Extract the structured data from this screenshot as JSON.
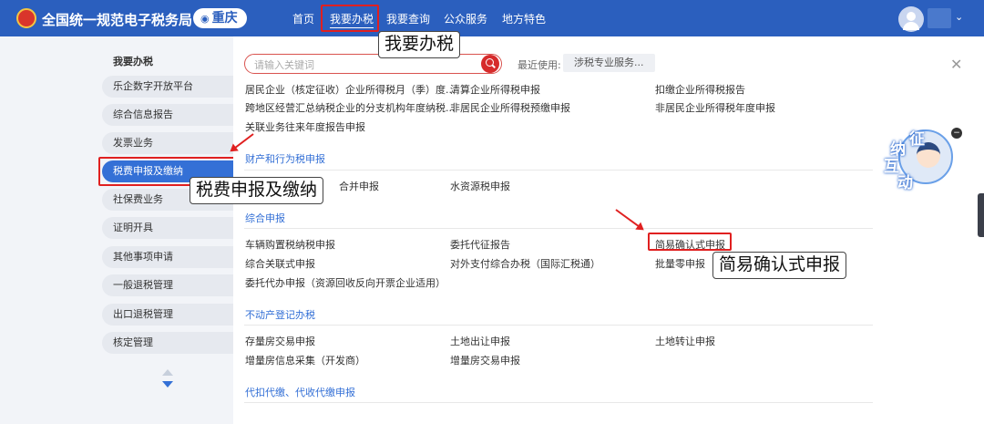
{
  "header": {
    "site_title": "全国统一规范电子税务局",
    "region": "重庆",
    "nav": [
      {
        "label": "首页"
      },
      {
        "label": "我要办税"
      },
      {
        "label": "我要查询"
      },
      {
        "label": "公众服务"
      },
      {
        "label": "地方特色"
      }
    ]
  },
  "sidebar": {
    "heading": "我要办税",
    "items": [
      {
        "label": "乐企数字开放平台"
      },
      {
        "label": "综合信息报告"
      },
      {
        "label": "发票业务"
      },
      {
        "label": "税费申报及缴纳"
      },
      {
        "label": "社保费业务"
      },
      {
        "label": "证明开具"
      },
      {
        "label": "其他事项申请"
      },
      {
        "label": "一般退税管理"
      },
      {
        "label": "出口退税管理"
      },
      {
        "label": "核定管理"
      }
    ]
  },
  "search": {
    "placeholder": "请输入关键词"
  },
  "recent": {
    "label": "最近使用:",
    "chip": "涉税专业服务..."
  },
  "content": {
    "top_rows": [
      [
        "居民企业（核定征收）企业所得税月（季）度...",
        "清算企业所得税申报",
        "扣缴企业所得税报告"
      ],
      [
        "跨地区经营汇总纳税企业的分支机构年度纳税...",
        "非居民企业所得税预缴申报",
        "非居民企业所得税年度申报"
      ],
      [
        "关联业务往来年度报告申报"
      ]
    ],
    "sections": [
      {
        "title": "财产和行为税申报",
        "rows": [
          [
            "合并申报",
            "水资源税申报"
          ]
        ]
      },
      {
        "title": "综合申报",
        "rows": [
          [
            "车辆购置税纳税申报",
            "委托代征报告",
            "简易确认式申报"
          ],
          [
            "综合关联式申报",
            "对外支付综合办税（国际汇税通）",
            "批量零申报"
          ],
          [
            "委托代办申报（资源回收反向开票企业适用）"
          ]
        ]
      },
      {
        "title": "不动产登记办税",
        "rows": [
          [
            "存量房交易申报",
            "土地出让申报",
            "土地转让申报"
          ],
          [
            "增量房信息采集（开发商）",
            "增量房交易申报"
          ]
        ]
      },
      {
        "title": "代扣代缴、代收代缴申报",
        "rows": []
      }
    ]
  },
  "callouts": {
    "nav": "我要办税",
    "sidebar": "税费申报及缴纳",
    "item": "简易确认式申报"
  },
  "mascot": {
    "chars": [
      "征",
      "纳",
      "互",
      "动"
    ]
  },
  "colors": {
    "header": "#2b5fbe",
    "accent": "#3470d6",
    "highlight": "#e02020"
  }
}
